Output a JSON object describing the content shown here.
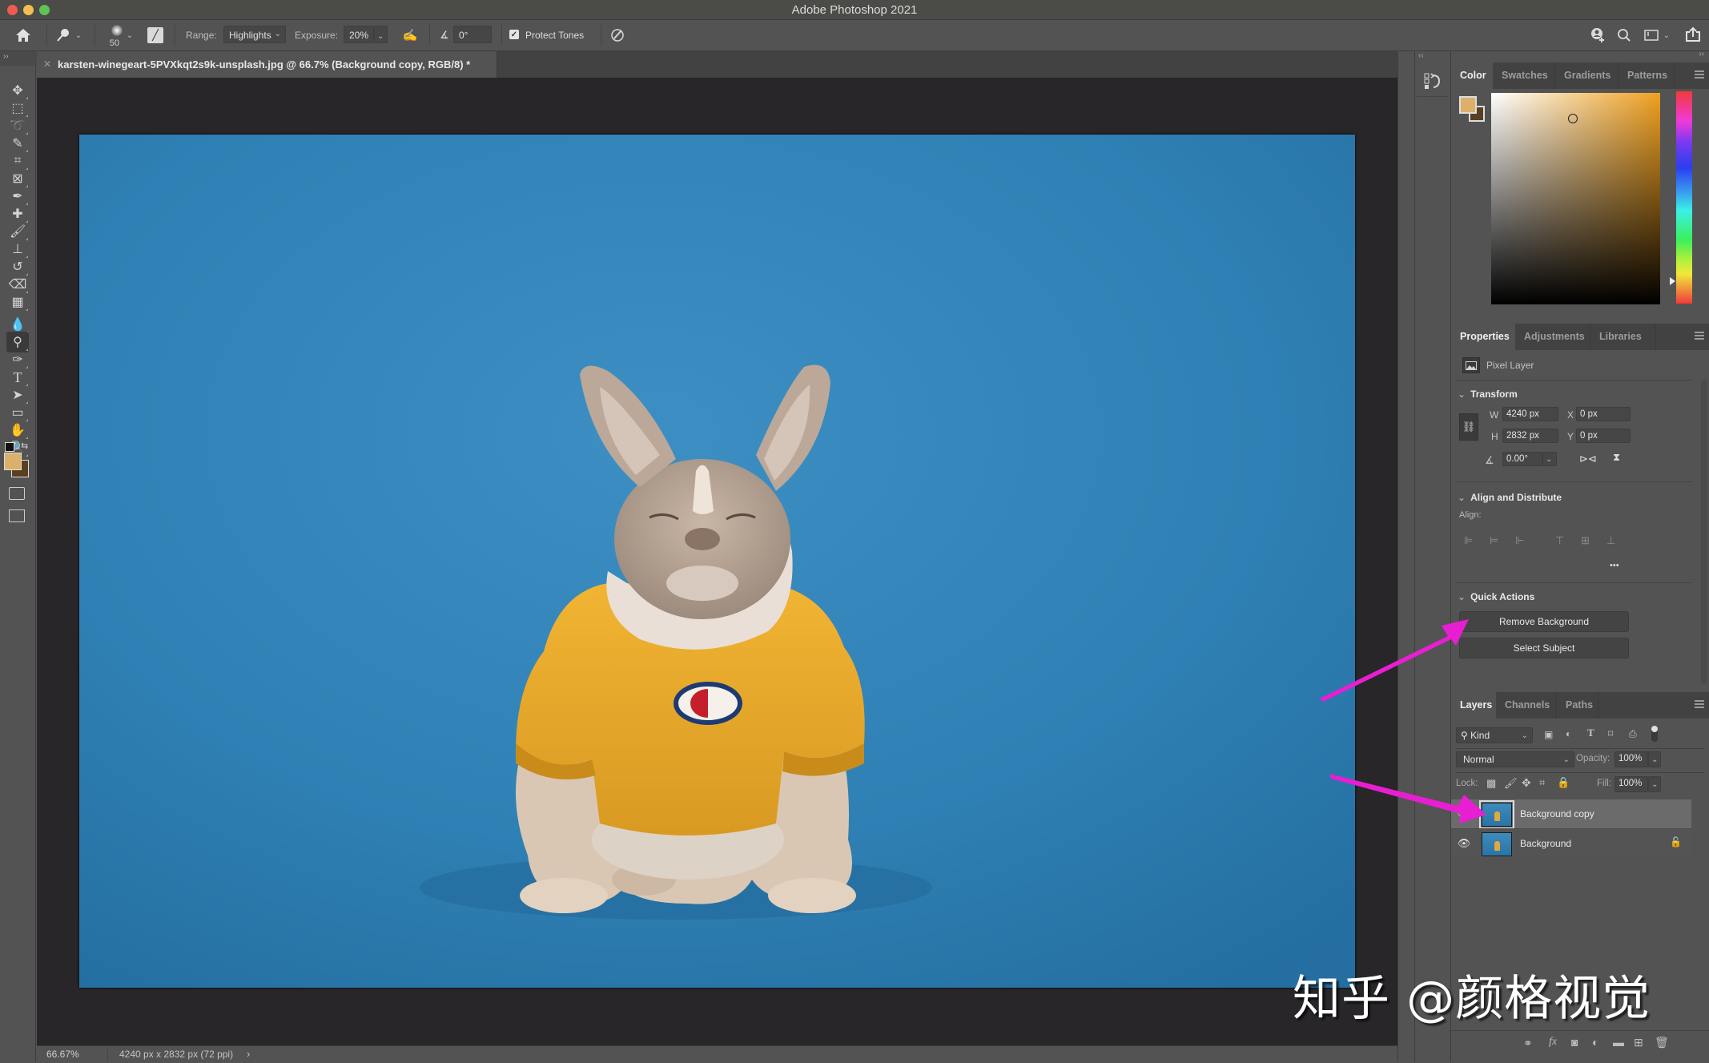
{
  "window": {
    "title": "Adobe Photoshop 2021",
    "traffic_lights": [
      "close",
      "minimize",
      "zoom"
    ]
  },
  "options_bar": {
    "brush_size": "50",
    "range_label": "Range:",
    "range_value": "Highlights",
    "exposure_label": "Exposure:",
    "exposure_value": "20%",
    "angle_value": "0°",
    "protect_tones_label": "Protect Tones",
    "protect_tones_checked": true
  },
  "document": {
    "tab_title": "karsten-winegeart-5PVXkqt2s9k-unsplash.jpg @ 66.7% (Background copy, RGB/8) *",
    "canvas_bg_color": "#282629",
    "image_bg_color": "#2f80b4"
  },
  "status_bar": {
    "zoom": "66.67%",
    "dimensions": "4240 px x 2832 px (72 ppi)",
    "more": "›"
  },
  "tools": [
    {
      "name": "move-tool",
      "glyph": "✥"
    },
    {
      "name": "marquee-tool",
      "glyph": "⬚"
    },
    {
      "name": "lasso-tool",
      "glyph": "➰"
    },
    {
      "name": "quick-selection-tool",
      "glyph": "✎"
    },
    {
      "name": "crop-tool",
      "glyph": "⌗"
    },
    {
      "name": "frame-tool",
      "glyph": "⊠"
    },
    {
      "name": "eyedropper-tool",
      "glyph": "✒"
    },
    {
      "name": "healing-brush-tool",
      "glyph": "✚"
    },
    {
      "name": "brush-tool",
      "glyph": "🖌"
    },
    {
      "name": "clone-stamp-tool",
      "glyph": "⊥"
    },
    {
      "name": "history-brush-tool",
      "glyph": "↺"
    },
    {
      "name": "eraser-tool",
      "glyph": "⌫"
    },
    {
      "name": "gradient-tool",
      "glyph": "▦"
    },
    {
      "name": "blur-tool",
      "glyph": "💧"
    },
    {
      "name": "dodge-tool",
      "glyph": "⚲",
      "active": true
    },
    {
      "name": "pen-tool",
      "glyph": "✑"
    },
    {
      "name": "type-tool",
      "glyph": "T"
    },
    {
      "name": "path-selection-tool",
      "glyph": "➤"
    },
    {
      "name": "rectangle-tool",
      "glyph": "▭"
    },
    {
      "name": "hand-tool",
      "glyph": "✋"
    },
    {
      "name": "zoom-tool",
      "glyph": "🔍"
    },
    {
      "name": "edit-toolbar",
      "glyph": "•••"
    }
  ],
  "colors": {
    "foreground": "#dcb06a",
    "background": "#5a4022",
    "picker_hue": "#f0a020"
  },
  "color_panel": {
    "tabs": [
      "Color",
      "Swatches",
      "Gradients",
      "Patterns"
    ],
    "active_tab": "Color"
  },
  "properties_panel": {
    "tabs": [
      "Properties",
      "Adjustments",
      "Libraries"
    ],
    "active_tab": "Properties",
    "layer_type": "Pixel Layer",
    "transform": {
      "heading": "Transform",
      "w_label": "W",
      "w_value": "4240 px",
      "h_label": "H",
      "h_value": "2832 px",
      "x_label": "X",
      "x_value": "0 px",
      "y_label": "Y",
      "y_value": "0 px",
      "angle_value": "0.00°"
    },
    "align": {
      "heading": "Align and Distribute",
      "align_label": "Align:",
      "more": "•••"
    },
    "quick_actions": {
      "heading": "Quick Actions",
      "buttons": [
        "Remove Background",
        "Select Subject"
      ]
    }
  },
  "layers_panel": {
    "tabs": [
      "Layers",
      "Channels",
      "Paths"
    ],
    "active_tab": "Layers",
    "filter_kind": "Kind",
    "blend_mode": "Normal",
    "opacity_label": "Opacity:",
    "opacity_value": "100%",
    "lock_label": "Lock:",
    "fill_label": "Fill:",
    "fill_value": "100%",
    "layers": [
      {
        "name": "Background copy",
        "visible": true,
        "selected": true,
        "locked": false
      },
      {
        "name": "Background",
        "visible": true,
        "selected": false,
        "locked": true
      }
    ]
  },
  "annotations": {
    "arrow_color": "#e81ed2",
    "watermark": "知乎 @颜格视觉"
  }
}
